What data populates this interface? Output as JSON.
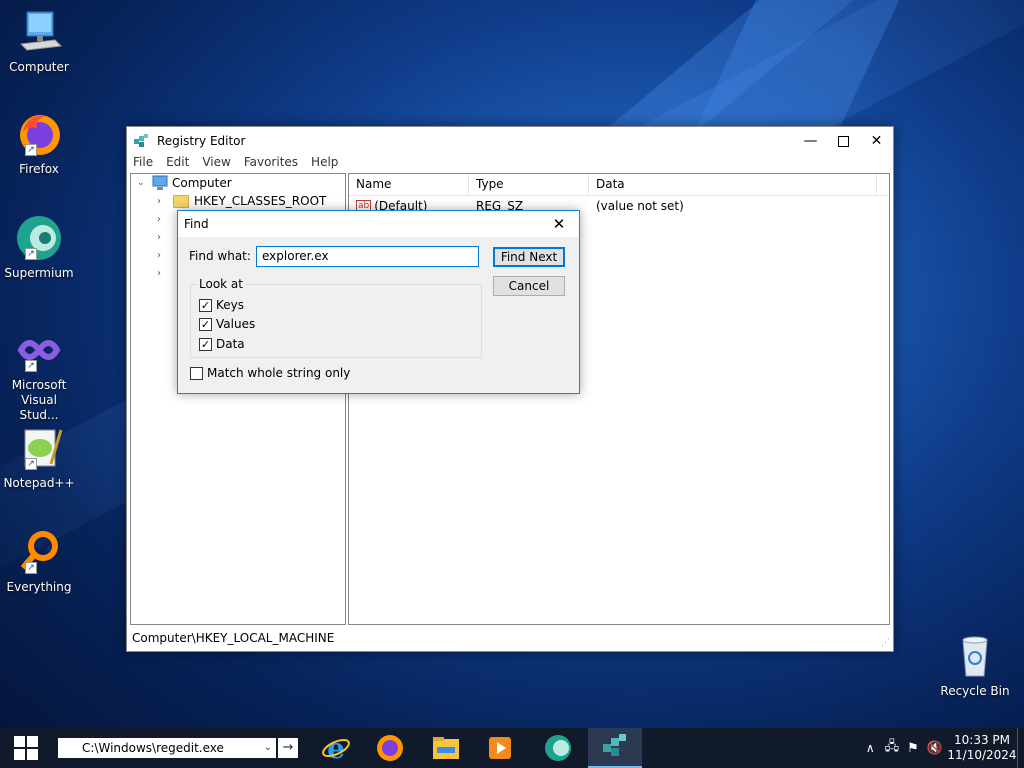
{
  "desktop": {
    "icons": [
      {
        "label": "Computer"
      },
      {
        "label": "Firefox"
      },
      {
        "label": "Supermium"
      },
      {
        "label": "Microsoft Visual Stud..."
      },
      {
        "label": "Notepad++"
      },
      {
        "label": "Everything"
      },
      {
        "label": "Recycle Bin"
      }
    ]
  },
  "window": {
    "title": "Registry Editor",
    "menu": [
      "File",
      "Edit",
      "View",
      "Favorites",
      "Help"
    ],
    "tree": {
      "root": "Computer",
      "first_child": "HKEY_CLASSES_ROOT"
    },
    "list": {
      "columns": [
        "Name",
        "Type",
        "Data"
      ],
      "rows": [
        {
          "name": "(Default)",
          "type": "REG_SZ",
          "data": "(value not set)"
        }
      ]
    },
    "status": "Computer\\HKEY_LOCAL_MACHINE"
  },
  "find_dialog": {
    "title": "Find",
    "find_what_label": "Find what:",
    "find_what_value": "explorer.ex",
    "find_next_label": "Find Next",
    "cancel_label": "Cancel",
    "look_at_label": "Look at",
    "keys_label": "Keys",
    "values_label": "Values",
    "data_label": "Data",
    "match_label": "Match whole string only",
    "keys_checked": true,
    "values_checked": true,
    "data_checked": true,
    "match_checked": false
  },
  "taskbar": {
    "run_text": "C:\\Windows\\regedit.exe",
    "time": "10:33 PM",
    "date": "11/10/2024",
    "accent": "#76b9ed"
  }
}
